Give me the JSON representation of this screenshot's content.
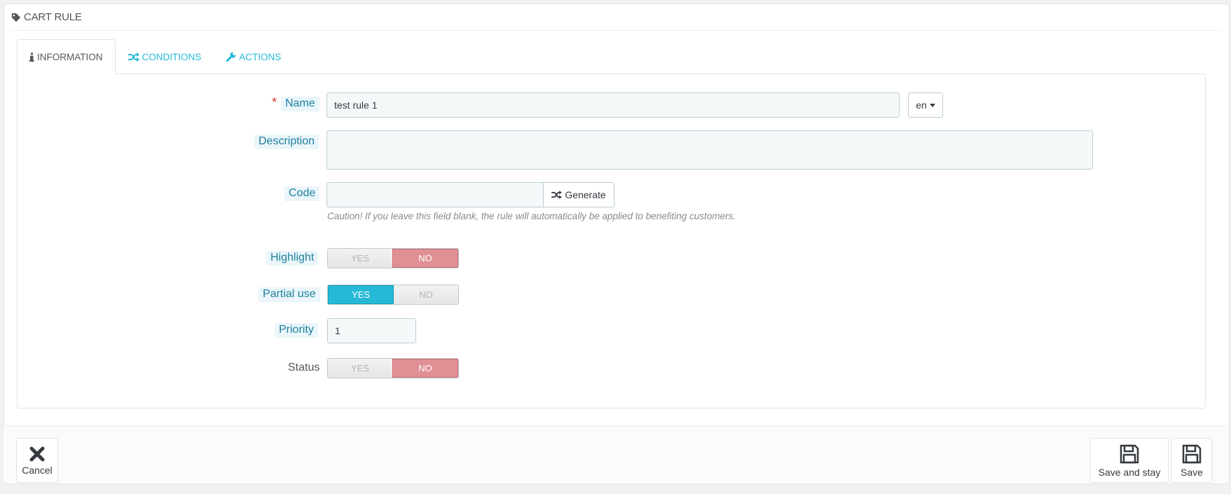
{
  "header": {
    "title": "CART RULE",
    "icon": "tag-icon"
  },
  "tabs": [
    {
      "label": "INFORMATION",
      "icon": "info-icon",
      "active": true
    },
    {
      "label": "CONDITIONS",
      "icon": "shuffle-icon",
      "active": false
    },
    {
      "label": "ACTIONS",
      "icon": "wrench-icon",
      "active": false
    }
  ],
  "form": {
    "name": {
      "label": "Name",
      "required_mark": "*",
      "value": "test rule 1",
      "lang": "en"
    },
    "description": {
      "label": "Description",
      "value": ""
    },
    "code": {
      "label": "Code",
      "value": "",
      "generate_label": "Generate",
      "help": "Caution! If you leave this field blank, the rule will automatically be applied to benefiting customers."
    },
    "highlight": {
      "label": "Highlight",
      "yes": "YES",
      "no": "NO",
      "selected": "NO"
    },
    "partial_use": {
      "label": "Partial use",
      "yes": "YES",
      "no": "NO",
      "selected": "YES"
    },
    "priority": {
      "label": "Priority",
      "value": "1"
    },
    "status": {
      "label": "Status",
      "yes": "YES",
      "no": "NO",
      "selected": "NO"
    }
  },
  "footer": {
    "cancel_label": "Cancel",
    "save_stay_label": "Save and stay",
    "save_label": "Save"
  },
  "colors": {
    "accent": "#25b9d7",
    "no_active": "#e08f95",
    "required": "#e13a3a"
  }
}
